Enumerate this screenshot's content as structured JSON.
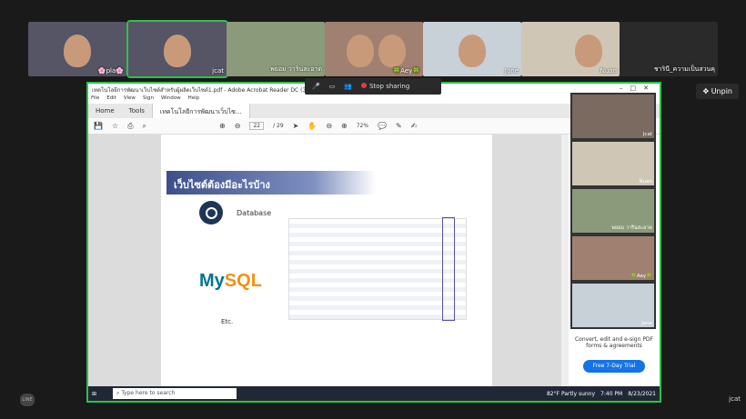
{
  "participants": [
    {
      "name": "🌸pla🌸"
    },
    {
      "name": "jcat"
    },
    {
      "name": "พยอม วารินสะอาด"
    },
    {
      "name": "🍀Aey🍀"
    },
    {
      "name": "Jane"
    },
    {
      "name": "Nuan"
    },
    {
      "name": "ชารินี_ความเป็นสวนคุ"
    }
  ],
  "unpin_label": "Unpin",
  "share": {
    "window_title": "เทคโนโลยีการพัฒนาเว็บไซต์สำหรับผู้ผลิตเว็บไซต์1.pdf - Adobe Acrobat Reader DC (32-bit)",
    "menu": [
      "File",
      "Edit",
      "View",
      "Sign",
      "Window",
      "Help"
    ],
    "tabs": [
      "Home",
      "Tools",
      "เทคโนโลยีการพัฒนาเว็บไซ..."
    ],
    "page_current": "22",
    "page_total": "/ 29",
    "zoom": "72%",
    "stop_label": "Stop sharing",
    "slide": {
      "title": "เว็บไซต์ต้องมีอะไรบ้าง",
      "database_label": "Database",
      "mysql_my": "My",
      "mysql_sql": "SQL",
      "etc_label": "Etc."
    },
    "gallery": [
      {
        "name": "jcat"
      },
      {
        "name": "Nuan"
      },
      {
        "name": "พยอม วารินสะอาด"
      },
      {
        "name": "🍀Aey🍀"
      },
      {
        "name": "Jane"
      }
    ],
    "promo_text": "Convert, edit and e-sign PDF forms & agreements",
    "trial_label": "Free 7-Day Trial",
    "taskbar": {
      "search_placeholder": "Type here to search",
      "weather": "82°F  Partly sunny",
      "time": "7:40 PM",
      "date": "8/23/2021"
    }
  },
  "line_label": "LINE",
  "self_name": "jcat"
}
